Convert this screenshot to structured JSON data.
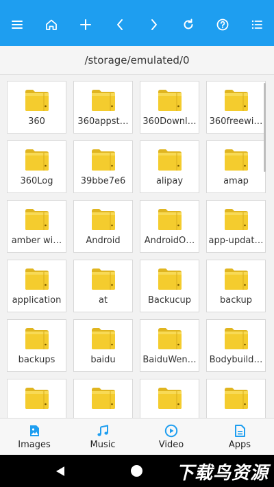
{
  "toolbar": {
    "icons": [
      "menu-icon",
      "home-icon",
      "plus-icon",
      "chevron-left-icon",
      "chevron-right-icon",
      "refresh-icon",
      "help-icon",
      "list-icon"
    ],
    "color": "#1e9ef0"
  },
  "path": {
    "current": "/storage/emulated/0"
  },
  "folders": [
    {
      "label": "360"
    },
    {
      "label": "360appst…"
    },
    {
      "label": "360Downl…"
    },
    {
      "label": "360freewi…"
    },
    {
      "label": "360Log"
    },
    {
      "label": "39bbe7e6"
    },
    {
      "label": "alipay"
    },
    {
      "label": "amap"
    },
    {
      "label": "amber wi…"
    },
    {
      "label": "Android"
    },
    {
      "label": "AndroidO…"
    },
    {
      "label": "app-updat…"
    },
    {
      "label": "application"
    },
    {
      "label": "at"
    },
    {
      "label": "Backucup"
    },
    {
      "label": "backup"
    },
    {
      "label": "backups"
    },
    {
      "label": "baidu"
    },
    {
      "label": "BaiduWen…"
    },
    {
      "label": "Bodybuild…"
    },
    {
      "label": ""
    },
    {
      "label": ""
    },
    {
      "label": ""
    },
    {
      "label": ""
    }
  ],
  "bottom_tabs": [
    {
      "label": "Images",
      "icon": "image-icon"
    },
    {
      "label": "Music",
      "icon": "music-icon"
    },
    {
      "label": "Video",
      "icon": "video-icon"
    },
    {
      "label": "Apps",
      "icon": "apps-icon"
    }
  ],
  "watermark": {
    "text": "下载鸟资源"
  },
  "colors": {
    "accent": "#1e9ef0",
    "folder": "#f4cc2e",
    "folder_shade": "#e0b520"
  }
}
